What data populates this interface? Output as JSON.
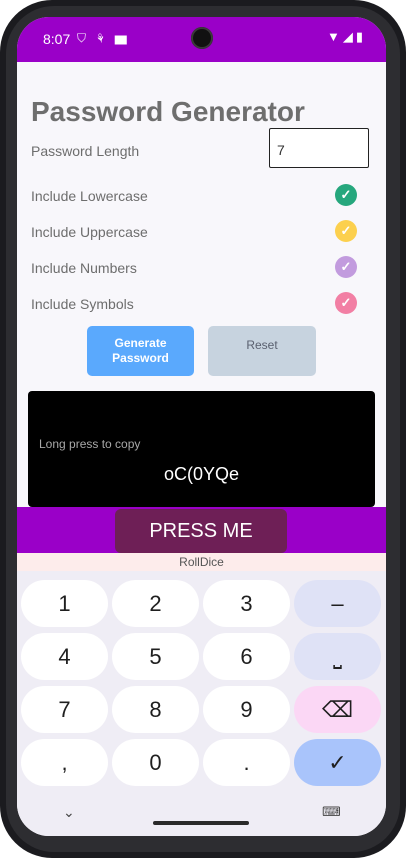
{
  "status": {
    "time": "8:07",
    "left_icons": "⛉ ⚘ ▆",
    "right_icons": "▼◢▮"
  },
  "app": {
    "title": "Password Generator",
    "length_label": "Password Length",
    "length_value": "7",
    "options": [
      {
        "label": "Include Lowercase",
        "color": "#26a77d",
        "checked": true
      },
      {
        "label": "Include Uppercase",
        "color": "#fcd04e",
        "checked": true
      },
      {
        "label": "Include Numbers",
        "color": "#c29bde",
        "checked": true
      },
      {
        "label": "Include Symbols",
        "color": "#f27fa4",
        "checked": true
      }
    ],
    "generate_label": "Generate Password",
    "reset_label": "Reset",
    "copy_hint": "Long press to copy",
    "password": "oC(0YQe"
  },
  "press_me": "PRESS ME",
  "roll_dice": "RollDice",
  "keyboard": {
    "keys": [
      [
        "1",
        "2",
        "3",
        "–"
      ],
      [
        "4",
        "5",
        "6",
        "⎵"
      ],
      [
        "7",
        "8",
        "9",
        "⌫"
      ],
      [
        ",",
        "0",
        ".",
        "✓"
      ]
    ]
  },
  "colors": {
    "accent": "#9a00c8",
    "press_button": "#6e1f56",
    "generate_button": "#5aa9fd",
    "reset_button": "#c7d3df"
  }
}
